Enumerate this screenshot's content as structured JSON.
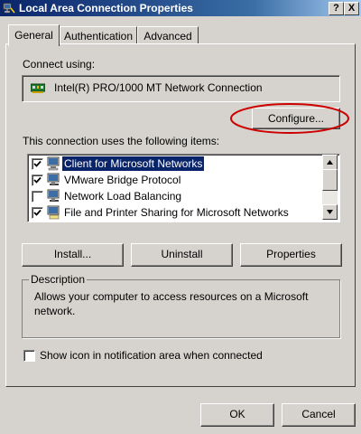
{
  "window": {
    "title": "Local Area Connection Properties",
    "help_label": "?",
    "close_label": "X"
  },
  "tabs": [
    {
      "label": "General",
      "active": true
    },
    {
      "label": "Authentication",
      "active": false
    },
    {
      "label": "Advanced",
      "active": false
    }
  ],
  "general": {
    "connect_using_label": "Connect using:",
    "adapter_name": "Intel(R) PRO/1000 MT Network Connection",
    "configure_label": "Configure...",
    "items_label": "This connection uses the following items:",
    "items": [
      {
        "label": "Client for Microsoft Networks",
        "checked": true,
        "selected": true,
        "icon": "network-client-icon"
      },
      {
        "label": "VMware Bridge Protocol",
        "checked": true,
        "selected": false,
        "icon": "network-protocol-icon"
      },
      {
        "label": "Network Load Balancing",
        "checked": false,
        "selected": false,
        "icon": "network-protocol-icon"
      },
      {
        "label": "File and Printer Sharing for Microsoft Networks",
        "checked": true,
        "selected": false,
        "icon": "network-service-icon"
      }
    ],
    "install_label": "Install...",
    "uninstall_label": "Uninstall",
    "properties_label": "Properties",
    "description_title": "Description",
    "description_text": "Allows your computer to access resources on a Microsoft network.",
    "show_icon_label": "Show icon in notification area when connected",
    "show_icon_checked": false
  },
  "footer": {
    "ok_label": "OK",
    "cancel_label": "Cancel"
  },
  "colors": {
    "titlebar": "#0a246a",
    "face": "#d6d3ce",
    "selection": "#0a246a",
    "annotation": "#cc0000"
  }
}
